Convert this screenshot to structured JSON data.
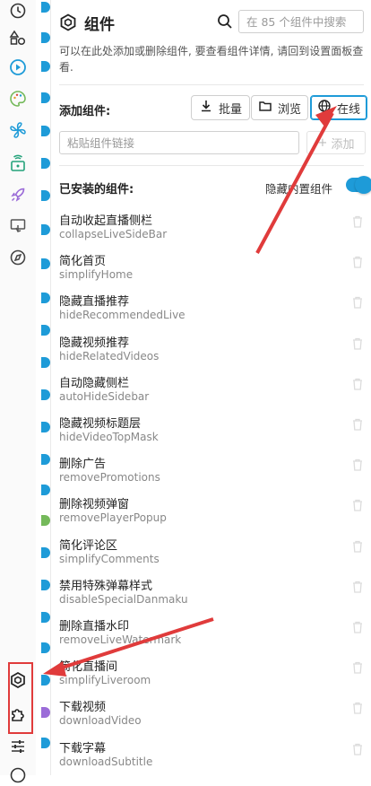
{
  "colors": {
    "accent": "#1e9bd8",
    "annotation": "#e03b3b"
  },
  "header": {
    "title": "组件",
    "search_placeholder": "在 85 个组件中搜索",
    "description": "可以在此处添加或删除组件, 要查看组件详情, 请回到设置面板查看."
  },
  "add": {
    "label": "添加组件:",
    "buttons": [
      {
        "label": "批量",
        "icon": "download-icon"
      },
      {
        "label": "浏览",
        "icon": "folder-icon"
      },
      {
        "label": "在线",
        "icon": "globe-icon",
        "active": true
      }
    ],
    "url_placeholder": "粘贴组件链接",
    "add_label": "添加"
  },
  "installed": {
    "label": "已安装的组件:",
    "toggle_label": "隐藏内置组件",
    "toggle_on": true,
    "items": [
      {
        "name": "自动收起直播侧栏",
        "id": "collapseLiveSideBar"
      },
      {
        "name": "简化首页",
        "id": "simplifyHome"
      },
      {
        "name": "隐藏直播推荐",
        "id": "hideRecommendedLive"
      },
      {
        "name": "隐藏视频推荐",
        "id": "hideRelatedVideos"
      },
      {
        "name": "自动隐藏侧栏",
        "id": "autoHideSidebar"
      },
      {
        "name": "隐藏视频标题层",
        "id": "hideVideoTopMask"
      },
      {
        "name": "删除广告",
        "id": "removePromotions"
      },
      {
        "name": "删除视频弹窗",
        "id": "removePlayerPopup"
      },
      {
        "name": "简化评论区",
        "id": "simplifyComments"
      },
      {
        "name": "禁用特殊弹幕样式",
        "id": "disableSpecialDanmaku"
      },
      {
        "name": "删除直播水印",
        "id": "removeLiveWatermark"
      },
      {
        "name": "简化直播间",
        "id": "simplifyLiveroom"
      },
      {
        "name": "下载视频",
        "id": "downloadVideo"
      },
      {
        "name": "下载字幕",
        "id": "downloadSubtitle"
      }
    ]
  },
  "sidebar": {
    "icons": [
      "clock-icon",
      "shapes-icon",
      "play-circle-icon",
      "palette-icon",
      "fan-icon",
      "cast-icon",
      "rocket-icon",
      "touch-screen-icon",
      "compass-icon",
      "components-icon",
      "puzzle-icon",
      "sliders-icon"
    ]
  }
}
